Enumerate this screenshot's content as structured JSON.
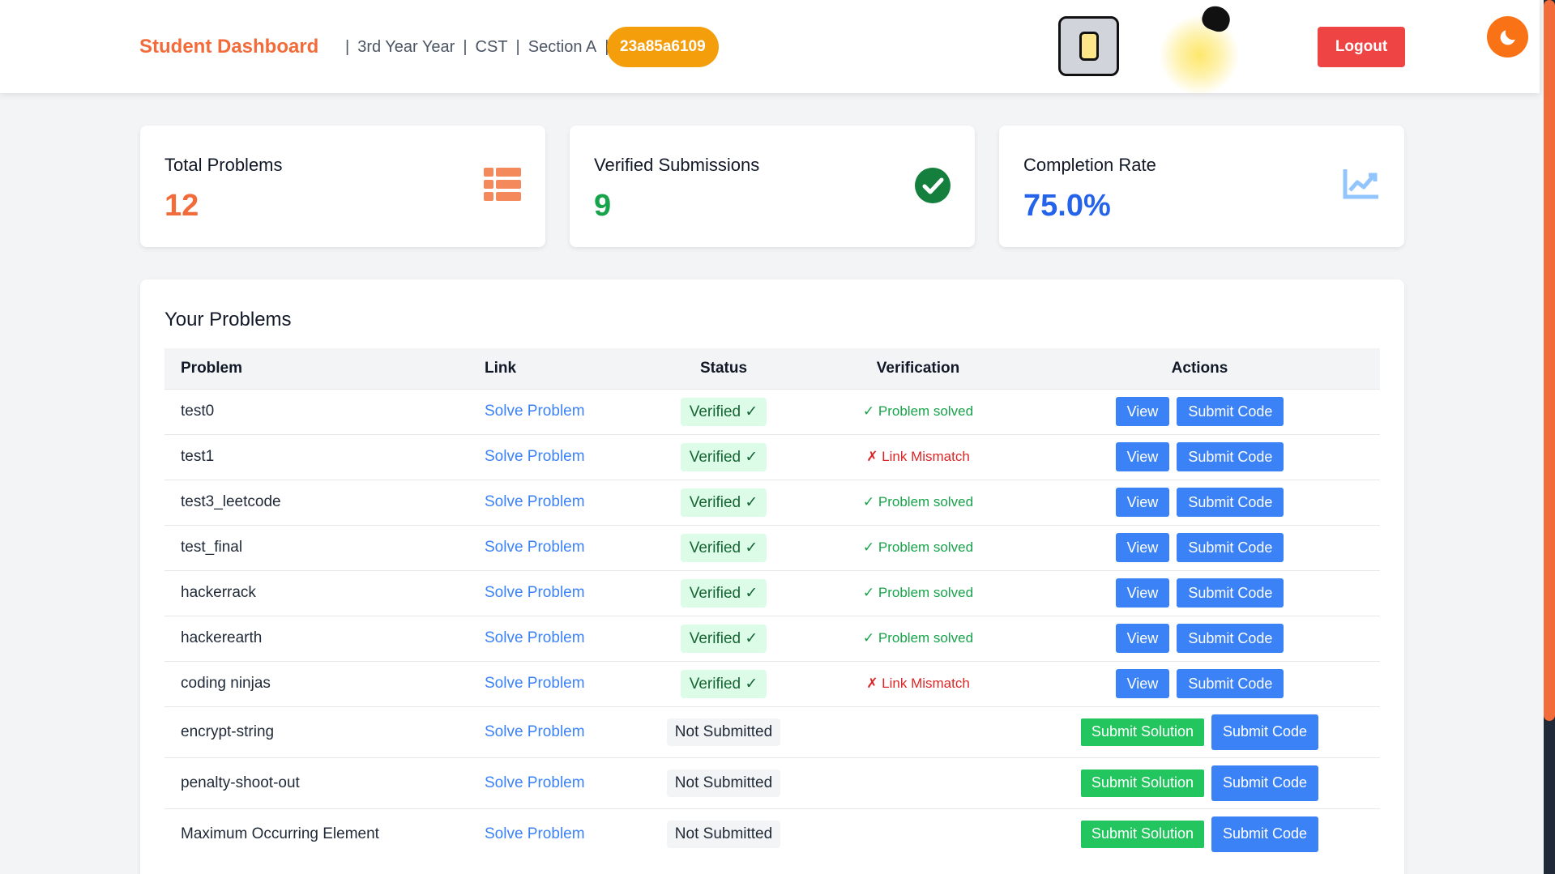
{
  "header": {
    "brand": "Student Dashboard",
    "year": "3rd Year Year",
    "branch": "CST",
    "section": "Section A",
    "separator": "|",
    "roll_no": "23a85a6109",
    "logout_label": "Logout"
  },
  "stats": [
    {
      "label": "Total Problems",
      "value": "12",
      "icon": "table-icon",
      "color": "#f26b3a"
    },
    {
      "label": "Verified Submissions",
      "value": "9",
      "icon": "check-circle-icon",
      "color": "#16a34a"
    },
    {
      "label": "Completion Rate",
      "value": "75.0%",
      "icon": "chart-line-icon",
      "color": "#2563eb"
    }
  ],
  "problems_panel": {
    "title": "Your Problems",
    "columns": [
      "Problem",
      "Link",
      "Status",
      "Verification",
      "Actions"
    ],
    "rows": [
      {
        "problem": "test0",
        "link": "Solve Problem",
        "status": "Verified ✓",
        "verification": "✓ Problem solved",
        "ver_ok": true
      },
      {
        "problem": "test1",
        "link": "Solve Problem",
        "status": "Verified ✓",
        "verification": "✗ Link Mismatch",
        "ver_ok": false
      },
      {
        "problem": "test3_leetcode",
        "link": "Solve Problem",
        "status": "Verified ✓",
        "verification": "✓ Problem solved",
        "ver_ok": true
      },
      {
        "problem": "test_final",
        "link": "Solve Problem",
        "status": "Verified ✓",
        "verification": "✓ Problem solved",
        "ver_ok": true
      },
      {
        "problem": "hackerrack",
        "link": "Solve Problem",
        "status": "Verified ✓",
        "verification": "✓ Problem solved",
        "ver_ok": true
      },
      {
        "problem": "hackerearth",
        "link": "Solve Problem",
        "status": "Verified ✓",
        "verification": "✓ Problem solved",
        "ver_ok": true
      },
      {
        "problem": "coding ninjas",
        "link": "Solve Problem",
        "status": "Verified ✓",
        "verification": "✗ Link Mismatch",
        "ver_ok": false
      },
      {
        "problem": "encrypt-string",
        "link": "Solve Problem",
        "status": "Not Submitted",
        "verification": "",
        "ver_ok": null
      },
      {
        "problem": "penalty-shoot-out",
        "link": "Solve Problem",
        "status": "Not Submitted",
        "verification": "",
        "ver_ok": null
      },
      {
        "problem": "Maximum Occurring Element",
        "link": "Solve Problem",
        "status": "Not Submitted",
        "verification": "",
        "ver_ok": null
      }
    ],
    "view_label": "View",
    "submit_code_label": "Submit Code",
    "submit_solution_label": "Submit Solution"
  }
}
